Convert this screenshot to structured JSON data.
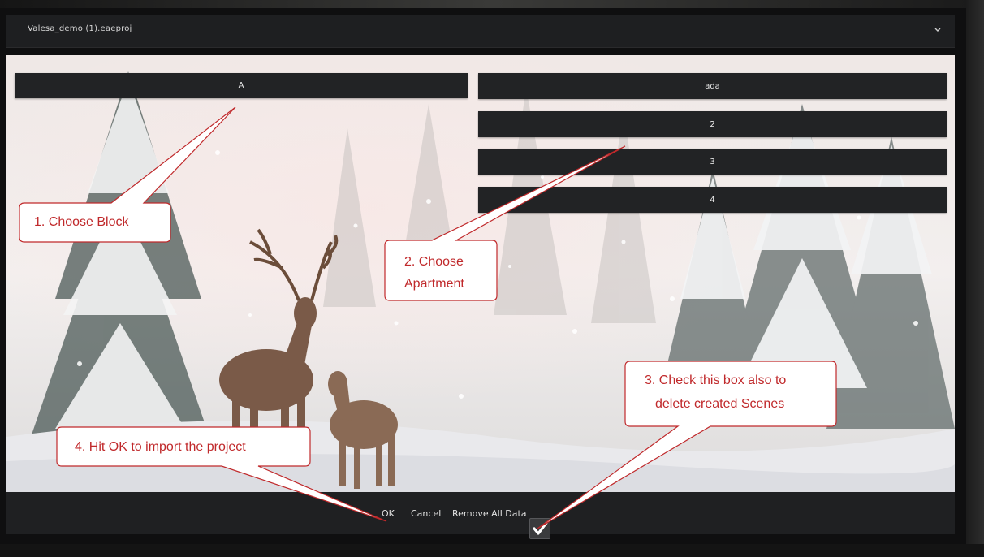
{
  "file_selector": {
    "filename": "Valesa_demo (1).eaeproj",
    "chevron_icon": "chevron-down-icon"
  },
  "blocks": {
    "items": [
      "A"
    ]
  },
  "apartments": {
    "items": [
      "ada",
      "2",
      "3",
      "4"
    ]
  },
  "footer": {
    "ok_label": "OK",
    "cancel_label": "Cancel",
    "remove_all_label": "Remove All Data",
    "remove_all_checked": true,
    "checkbox_icon": "checkmark-icon"
  },
  "annotations": {
    "step1": "1. Choose Block",
    "step2_line1": "2. Choose",
    "step2_line2": "Apartment",
    "step3_line1": "3. Check this box also to",
    "step3_line2": "delete created Scenes",
    "step4": "4. Hit OK to import the project"
  },
  "colors": {
    "annotation_text": "#c0292b",
    "annotation_border": "#c0292b",
    "bar_background": "#222325"
  }
}
